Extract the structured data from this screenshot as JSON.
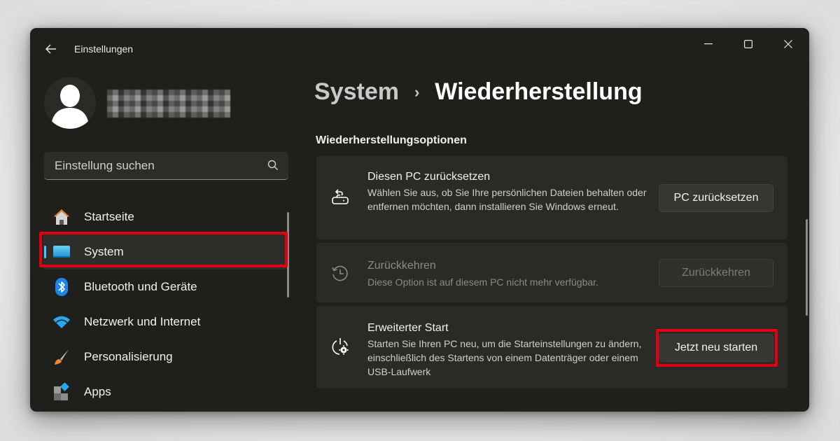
{
  "window": {
    "title": "Einstellungen",
    "controls": {
      "minimize": "minimize-icon",
      "maximize": "maximize-icon",
      "close": "close-icon"
    }
  },
  "profile": {
    "username": ""
  },
  "search": {
    "placeholder": "Einstellung suchen",
    "value": ""
  },
  "sidebar": {
    "items": [
      {
        "label": "Startseite",
        "icon": "home-icon",
        "active": false
      },
      {
        "label": "System",
        "icon": "system-monitor-icon",
        "active": true
      },
      {
        "label": "Bluetooth und Geräte",
        "icon": "bluetooth-icon",
        "active": false
      },
      {
        "label": "Netzwerk und Internet",
        "icon": "wifi-icon",
        "active": false
      },
      {
        "label": "Personalisierung",
        "icon": "brush-icon",
        "active": false
      },
      {
        "label": "Apps",
        "icon": "apps-icon",
        "active": false
      }
    ]
  },
  "breadcrumb": {
    "parent": "System",
    "separator": "›",
    "current": "Wiederherstellung"
  },
  "section": {
    "title": "Wiederherstellungsoptionen"
  },
  "options": [
    {
      "title": "Diesen PC zurücksetzen",
      "description": "Wählen Sie aus, ob Sie Ihre persönlichen Dateien behalten oder entfernen möchten, dann installieren Sie Windows erneut.",
      "button": "PC zurücksetzen",
      "icon": "reset-pc-icon",
      "enabled": true
    },
    {
      "title": "Zurückkehren",
      "description": "Diese Option ist auf diesem PC nicht mehr verfügbar.",
      "button": "Zurückkehren",
      "icon": "history-icon",
      "enabled": false
    },
    {
      "title": "Erweiterter Start",
      "description": "Starten Sie Ihren PC neu, um die Starteinstellungen zu ändern, einschließlich des Startens von einem Datenträger oder einem USB-Laufwerk",
      "button": "Jetzt neu starten",
      "icon": "advanced-startup-icon",
      "enabled": true
    }
  ],
  "colors": {
    "accent": "#4cc2ff",
    "highlight": "#e10010",
    "window_bg": "#1f201c",
    "card_bg": "#2a2b27"
  }
}
